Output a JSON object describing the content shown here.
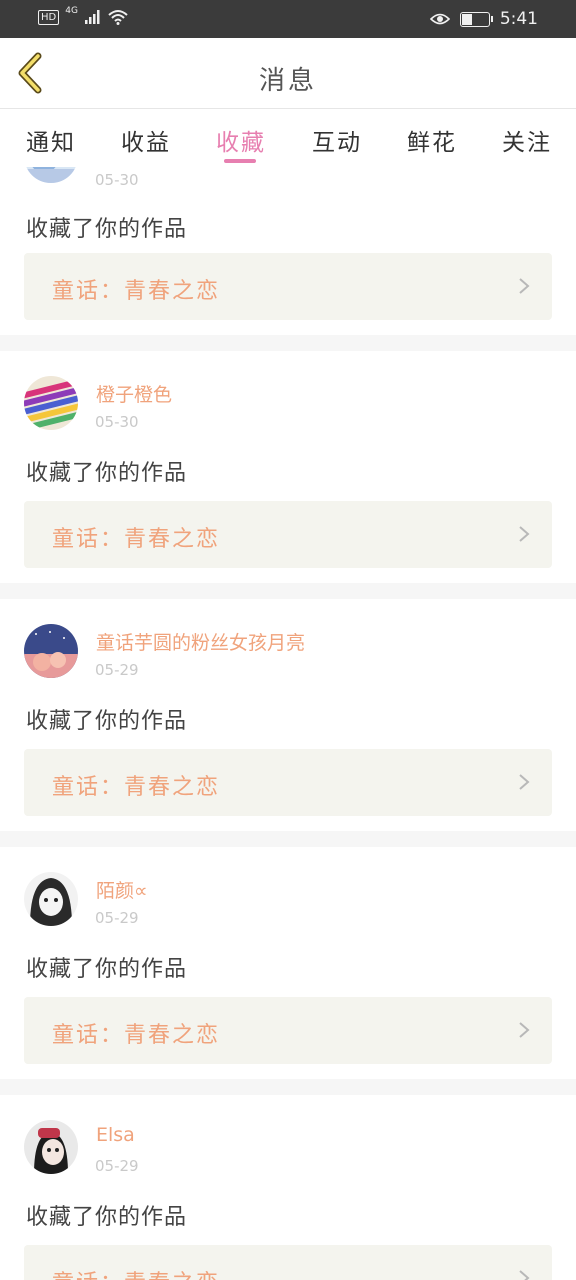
{
  "status_bar": {
    "left_badges": [
      "HD",
      "4G"
    ],
    "time": "5:41"
  },
  "header": {
    "title": "消息"
  },
  "tabs": [
    {
      "label": "通知",
      "active": false
    },
    {
      "label": "收益",
      "active": false
    },
    {
      "label": "收藏",
      "active": true
    },
    {
      "label": "互动",
      "active": false
    },
    {
      "label": "鲜花",
      "active": false
    },
    {
      "label": "关注",
      "active": false
    }
  ],
  "items": [
    {
      "user": "",
      "date": "05-30",
      "action": "收藏了你的作品",
      "work": "童话：青春之恋"
    },
    {
      "user": "橙子橙色",
      "date": "05-30",
      "action": "收藏了你的作品",
      "work": "童话：青春之恋"
    },
    {
      "user": "童话芋圆的粉丝女孩月亮",
      "date": "05-29",
      "action": "收藏了你的作品",
      "work": "童话：青春之恋"
    },
    {
      "user": "陌颜∝",
      "date": "05-29",
      "action": "收藏了你的作品",
      "work": "童话：青春之恋"
    },
    {
      "user": "Elsa",
      "date": "05-29",
      "action": "收藏了你的作品",
      "work": "童话：青春之恋"
    }
  ],
  "colors": {
    "accent": "#e77fb0",
    "username": "#f0a37c",
    "work_bg": "#f4f4ee"
  }
}
